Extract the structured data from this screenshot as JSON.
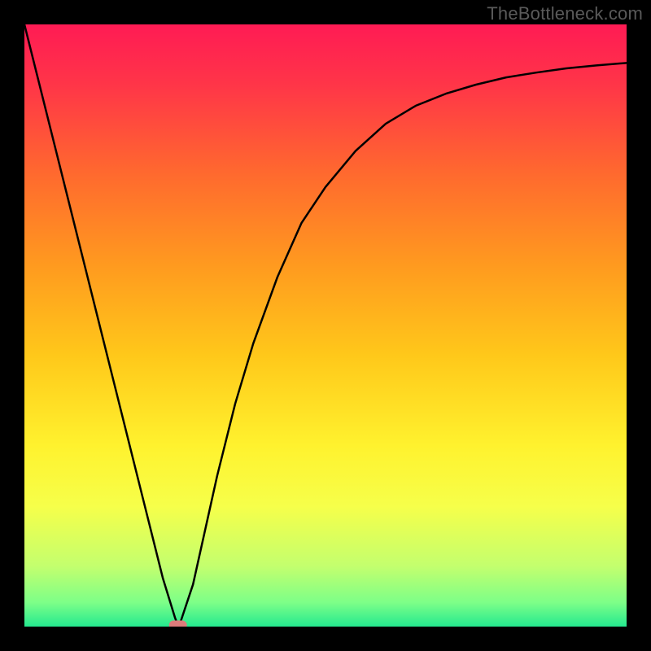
{
  "attribution": "TheBottleneck.com",
  "colors": {
    "frame": "#000000",
    "curve": "#000000",
    "marker_fill": "#dd7b7b",
    "gradient_stops": [
      {
        "offset": 0.0,
        "color": "#ff1b54"
      },
      {
        "offset": 0.1,
        "color": "#ff3548"
      },
      {
        "offset": 0.25,
        "color": "#ff6a2e"
      },
      {
        "offset": 0.4,
        "color": "#ff9a1f"
      },
      {
        "offset": 0.55,
        "color": "#ffc81a"
      },
      {
        "offset": 0.7,
        "color": "#fff22e"
      },
      {
        "offset": 0.8,
        "color": "#f6ff4a"
      },
      {
        "offset": 0.9,
        "color": "#c3ff6e"
      },
      {
        "offset": 0.96,
        "color": "#7dff88"
      },
      {
        "offset": 1.0,
        "color": "#24e98f"
      }
    ]
  },
  "chart_data": {
    "type": "line",
    "title": "",
    "xlabel": "",
    "ylabel": "",
    "xlim": [
      0,
      100
    ],
    "ylim": [
      0,
      1
    ],
    "grid": false,
    "legend": false,
    "annotations": [
      "TheBottleneck.com"
    ],
    "marker": {
      "x": 25.5,
      "y": 0.0,
      "shape": "pill",
      "color": "#dd7b7b"
    },
    "series": [
      {
        "name": "bottleneck-curve",
        "x": [
          0,
          5,
          10,
          15,
          20,
          23,
          25,
          25.5,
          26,
          28,
          30,
          32,
          35,
          38,
          42,
          46,
          50,
          55,
          60,
          65,
          70,
          75,
          80,
          85,
          90,
          95,
          100
        ],
        "y": [
          1.0,
          0.8,
          0.6,
          0.4,
          0.2,
          0.08,
          0.015,
          0.002,
          0.01,
          0.07,
          0.16,
          0.25,
          0.37,
          0.47,
          0.58,
          0.67,
          0.73,
          0.79,
          0.835,
          0.865,
          0.885,
          0.9,
          0.912,
          0.92,
          0.927,
          0.932,
          0.936
        ]
      }
    ]
  }
}
